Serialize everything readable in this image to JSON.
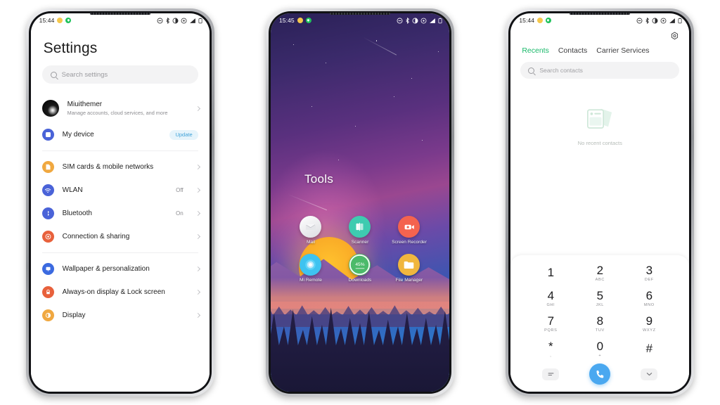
{
  "meta": {
    "accent_green": "#18b869",
    "accent_blue": "#4aa8f0",
    "badge_blue": "#3fa2d8"
  },
  "phone_settings": {
    "status_bar": {
      "time": "15:44",
      "icons": [
        "dnd-icon",
        "bluetooth-icon",
        "vibrate-icon",
        "location-icon",
        "signal-icon",
        "battery-icon"
      ]
    },
    "title": "Settings",
    "search": {
      "placeholder": "Search settings",
      "icon": "search-icon"
    },
    "account": {
      "name": "Miuithemer",
      "subtitle": "Manage accounts, cloud services, and more"
    },
    "device_row": {
      "label": "My device",
      "badge": "Update"
    },
    "items": [
      {
        "label": "SIM cards & mobile networks",
        "value": "",
        "color": "#f0a840",
        "icon": "sim-icon"
      },
      {
        "label": "WLAN",
        "value": "Off",
        "color": "#4a63d8",
        "icon": "wifi-icon"
      },
      {
        "label": "Bluetooth",
        "value": "On",
        "color": "#4a63d8",
        "icon": "bluetooth-icon"
      },
      {
        "label": "Connection & sharing",
        "value": "",
        "color": "#e8613c",
        "icon": "connection-icon"
      }
    ],
    "items2": [
      {
        "label": "Wallpaper & personalization",
        "value": "",
        "color": "#3b6ae0",
        "icon": "wallpaper-icon"
      },
      {
        "label": "Always-on display & Lock screen",
        "value": "",
        "color": "#e8613c",
        "icon": "lock-icon"
      },
      {
        "label": "Display",
        "value": "",
        "color": "#f0a840",
        "icon": "brightness-icon"
      }
    ]
  },
  "phone_home": {
    "status_bar": {
      "time": "15:45",
      "icons": [
        "dnd-icon",
        "bluetooth-icon",
        "vibrate-icon",
        "location-icon",
        "signal-icon",
        "battery-icon"
      ]
    },
    "folder_title": "Tools",
    "apps": [
      {
        "name": "Mail",
        "icon": "mail-icon",
        "color": "#f2f2f4"
      },
      {
        "name": "Scanner",
        "icon": "scanner-icon",
        "color": "#3ecbb0"
      },
      {
        "name": "Screen Recorder",
        "icon": "screen-recorder-icon",
        "color": "#f4634f"
      },
      {
        "name": "Mi Remote",
        "icon": "mi-remote-icon",
        "color": "#3ec3f0"
      },
      {
        "name": "Downloads",
        "icon": "downloads-icon",
        "color": "#4cba6a",
        "progress_label": "45%"
      },
      {
        "name": "File Manager",
        "icon": "file-manager-icon",
        "color": "#f0b63e"
      }
    ]
  },
  "phone_dialer": {
    "status_bar": {
      "time": "15:44",
      "icons": [
        "dnd-icon",
        "bluetooth-icon",
        "vibrate-icon",
        "location-icon",
        "signal-icon",
        "battery-icon"
      ]
    },
    "settings_icon": "gear-icon",
    "tabs": [
      {
        "label": "Recents",
        "active": true
      },
      {
        "label": "Contacts",
        "active": false
      },
      {
        "label": "Carrier Services",
        "active": false
      }
    ],
    "search": {
      "placeholder": "Search contacts",
      "icon": "search-icon"
    },
    "empty_state": {
      "text": "No recent contacts",
      "icon": "contact-card-icon"
    },
    "keypad": [
      {
        "digit": "1",
        "sub": ""
      },
      {
        "digit": "2",
        "sub": "ABC"
      },
      {
        "digit": "3",
        "sub": "DEF"
      },
      {
        "digit": "4",
        "sub": "GHI"
      },
      {
        "digit": "5",
        "sub": "JKL"
      },
      {
        "digit": "6",
        "sub": "MNO"
      },
      {
        "digit": "7",
        "sub": "PQRS"
      },
      {
        "digit": "8",
        "sub": "TUV"
      },
      {
        "digit": "9",
        "sub": "WXYZ"
      },
      {
        "digit": "*",
        "sub": ","
      },
      {
        "digit": "0",
        "sub": "+"
      },
      {
        "digit": "#",
        "sub": ""
      }
    ],
    "actions": {
      "left": "keypad-menu-icon",
      "call": "call-icon",
      "right": "collapse-keypad-icon"
    }
  }
}
